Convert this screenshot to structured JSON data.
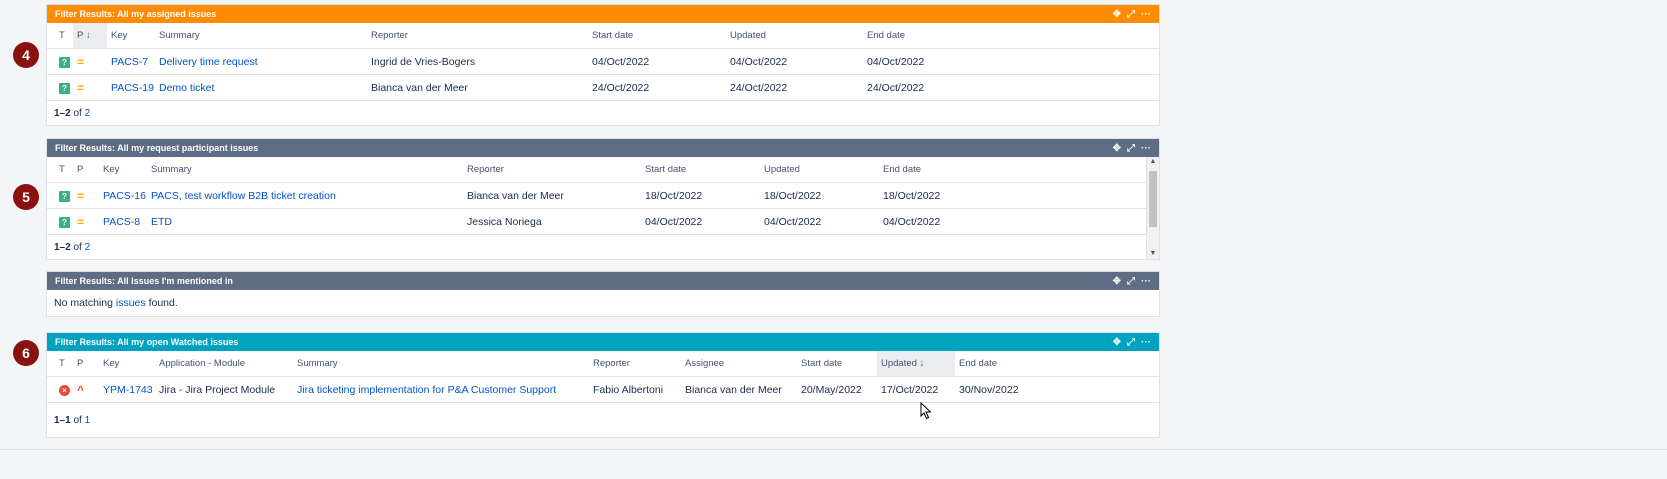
{
  "markers": [
    "4",
    "5",
    "6"
  ],
  "colors": {
    "orange": "#ff8b00",
    "slate": "#5e6c84",
    "teal": "#00a3bf"
  },
  "gadget1": {
    "title": "Filter Results: All my assigned issues",
    "columns": {
      "t": "T",
      "p": "P",
      "key": "Key",
      "summary": "Summary",
      "reporter": "Reporter",
      "start": "Start date",
      "updated": "Updated",
      "end": "End date"
    },
    "rows": [
      {
        "key": "PACS-7",
        "summary": "Delivery time request",
        "reporter": "Ingrid de Vries-Bogers",
        "start": "04/Oct/2022",
        "updated": "04/Oct/2022",
        "end": "04/Oct/2022"
      },
      {
        "key": "PACS-19",
        "summary": "Demo ticket",
        "reporter": "Bianca van der Meer",
        "start": "24/Oct/2022",
        "updated": "24/Oct/2022",
        "end": "24/Oct/2022"
      }
    ],
    "footer": {
      "range": "1–2",
      "of": "of",
      "total": "2"
    }
  },
  "gadget2": {
    "title": "Filter Results: All my request participant issues",
    "columns": {
      "t": "T",
      "p": "P",
      "key": "Key",
      "summary": "Summary",
      "reporter": "Reporter",
      "start": "Start date",
      "updated": "Updated",
      "end": "End date"
    },
    "rows": [
      {
        "key": "PACS-16",
        "summary": "PACS, test workflow B2B ticket creation",
        "reporter": "Bianca van der Meer",
        "start": "18/Oct/2022",
        "updated": "18/Oct/2022",
        "end": "18/Oct/2022"
      },
      {
        "key": "PACS-8",
        "summary": "ETD",
        "reporter": "Jessica Noriega",
        "start": "04/Oct/2022",
        "updated": "04/Oct/2022",
        "end": "04/Oct/2022"
      }
    ],
    "footer": {
      "range": "1–2",
      "of": "of",
      "total": "2"
    }
  },
  "gadget3": {
    "title": "Filter Results: All Issues I'm mentioned in",
    "no_match_prefix": "No matching",
    "no_match_link": "issues",
    "no_match_suffix": "found."
  },
  "gadget4": {
    "title": "Filter Results: All my open Watched issues",
    "columns": {
      "t": "T",
      "p": "P",
      "key": "Key",
      "module": "Application - Module",
      "summary": "Summary",
      "reporter": "Reporter",
      "assignee": "Assignee",
      "start": "Start date",
      "updated": "Updated",
      "end": "End date"
    },
    "rows": [
      {
        "key": "YPM-1743",
        "module": "Jira - Jira Project Module",
        "summary": "Jira ticketing implementation for P&A Customer Support",
        "reporter": "Fabio Albertoni",
        "assignee": "Bianca van der Meer",
        "start": "20/May/2022",
        "updated": "17/Oct/2022",
        "end": "30/Nov/2022"
      }
    ],
    "footer": {
      "range": "1–1",
      "of": "of",
      "total": "1"
    }
  },
  "icons": {
    "question": "?",
    "bug": "×",
    "medium": "=",
    "high": "^",
    "sort_down": "↓",
    "move": "✥",
    "expand": "⤢",
    "more": "···"
  }
}
